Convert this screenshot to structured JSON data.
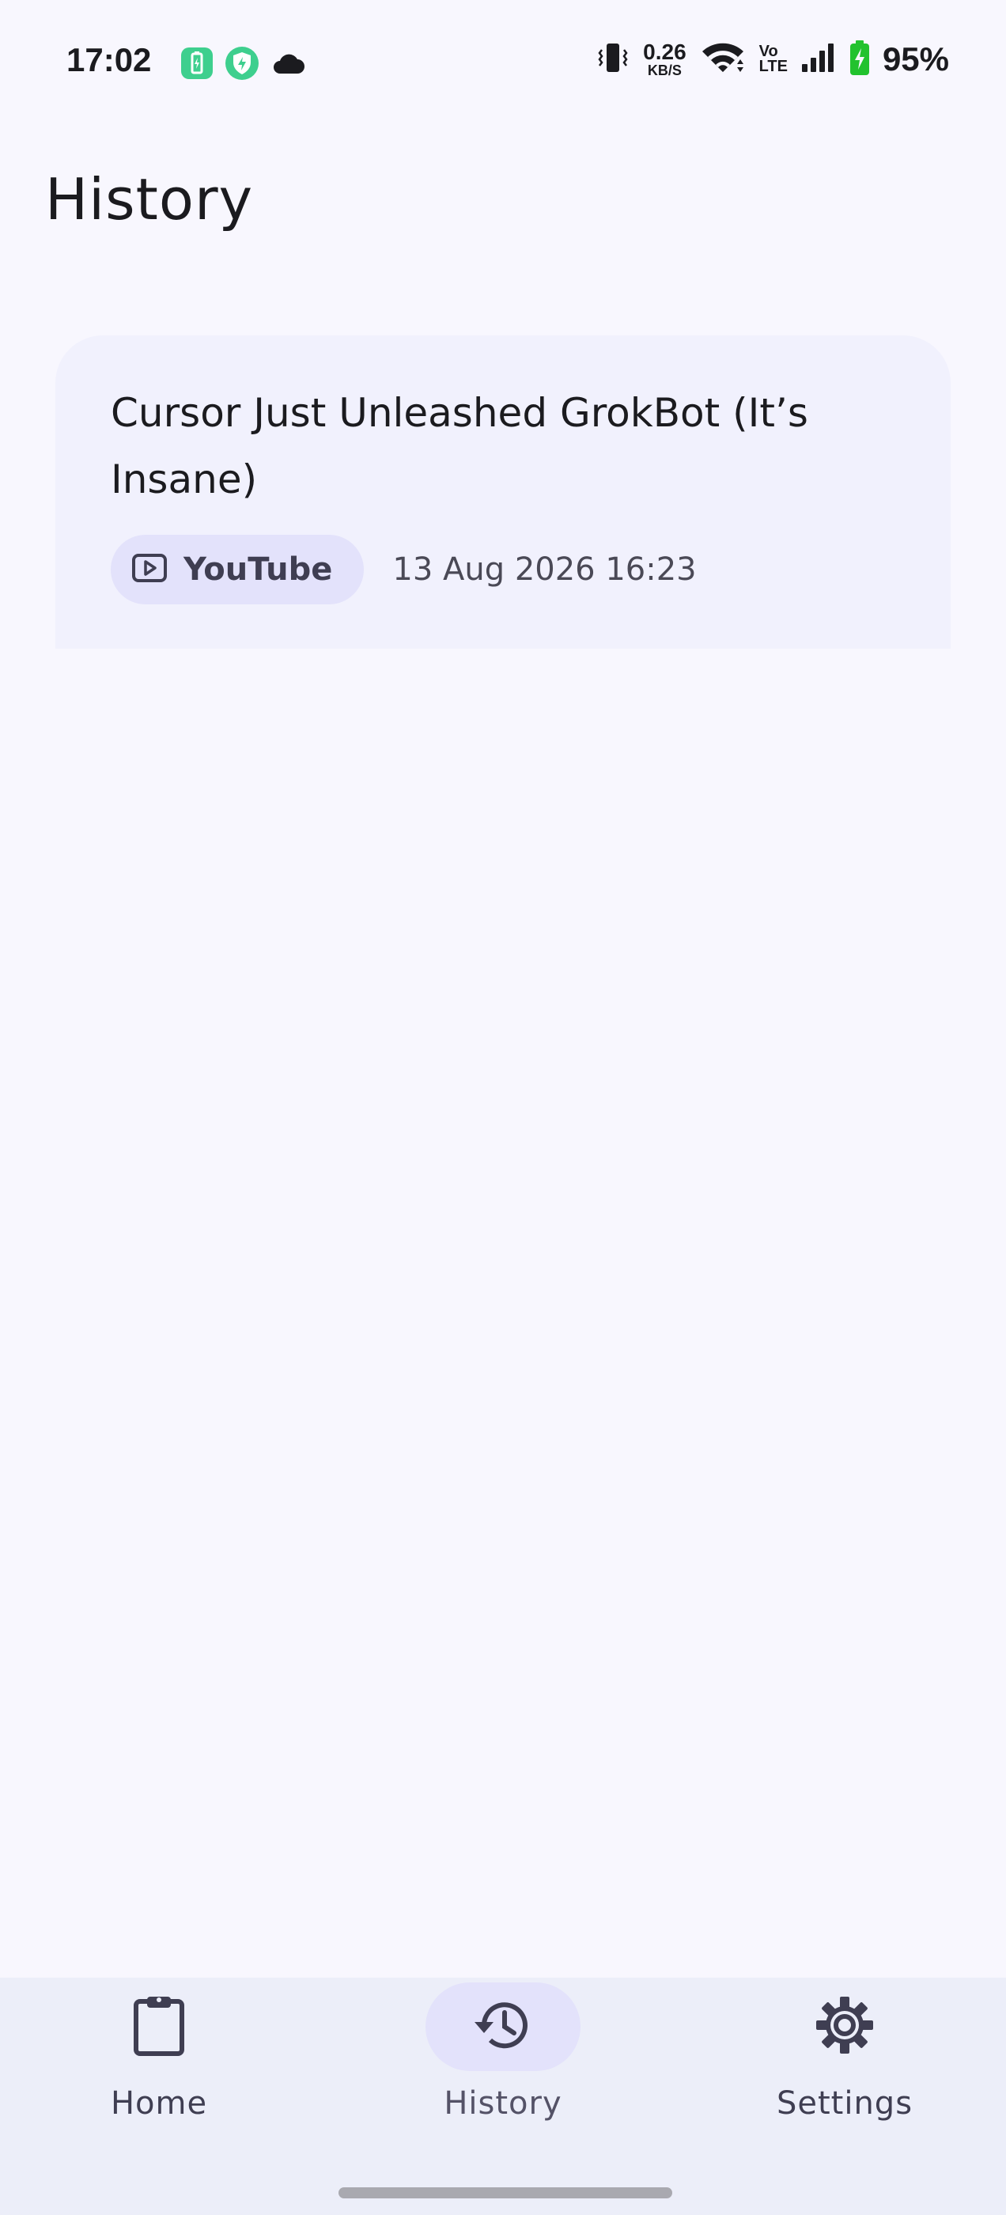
{
  "status_bar": {
    "time": "17:02",
    "net_speed_value": "0.26",
    "net_speed_unit": "KB/S",
    "volte_top": "Vo",
    "volte_bottom": "LTE",
    "battery_percent": "95%"
  },
  "page": {
    "title": "History"
  },
  "history": {
    "items": [
      {
        "title": "Cursor Just Unleashed GrokBot (It’s Insane)",
        "source": "YouTube",
        "timestamp": "13 Aug 2026 16:23"
      }
    ]
  },
  "bottom_nav": {
    "items": [
      {
        "label": "Home",
        "icon": "clipboard-icon",
        "active": false
      },
      {
        "label": "History",
        "icon": "history-icon",
        "active": true
      },
      {
        "label": "Settings",
        "icon": "gear-icon",
        "active": false
      }
    ]
  },
  "colors": {
    "background": "#f8f7fe",
    "card": "#f1f1fd",
    "chip": "#e3e2fb",
    "nav_background": "#eceef9",
    "battery_green": "#22c22e",
    "app_icon_green": "#3ecf8e"
  }
}
